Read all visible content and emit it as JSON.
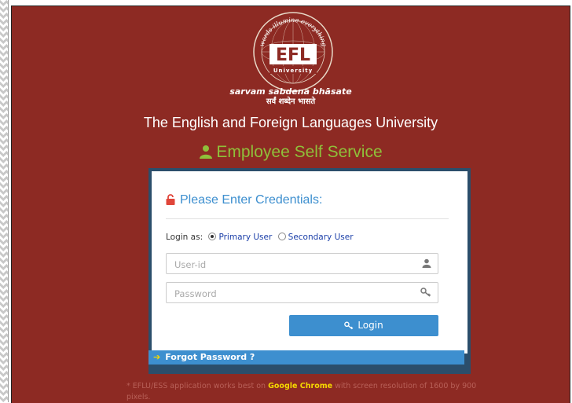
{
  "logo": {
    "arc_text": "words illumine everything",
    "mark": "EFL",
    "ring_text": "University"
  },
  "motto": {
    "line1": "sarvam sabdena bhāsate",
    "line2": "सर्वं शब्देन भासते"
  },
  "university_title": "The English and Foreign Languages University",
  "ess_title": "Employee Self Service",
  "login": {
    "heading": "Please Enter Credentials:",
    "login_as_label": "Login as:",
    "options": [
      "Primary User",
      "Secondary User"
    ],
    "selected": "Primary User",
    "userid_placeholder": "User-id",
    "password_placeholder": "Password",
    "button_label": "Login",
    "forgot_label": "Forgot Password ?"
  },
  "note": {
    "pre": "* EFLU/ESS application works best on ",
    "browser": "Google Chrome",
    "post": " with screen resolution of 1600 by 900 pixels."
  },
  "colors": {
    "background": "#8d2a23",
    "accent_blue": "#3d8fcf",
    "ess_green": "#8fbf3a",
    "highlight_yellow": "#f5d800"
  },
  "icons": [
    "user-icon",
    "unlock-icon",
    "key-icon",
    "arrow-right-icon"
  ]
}
